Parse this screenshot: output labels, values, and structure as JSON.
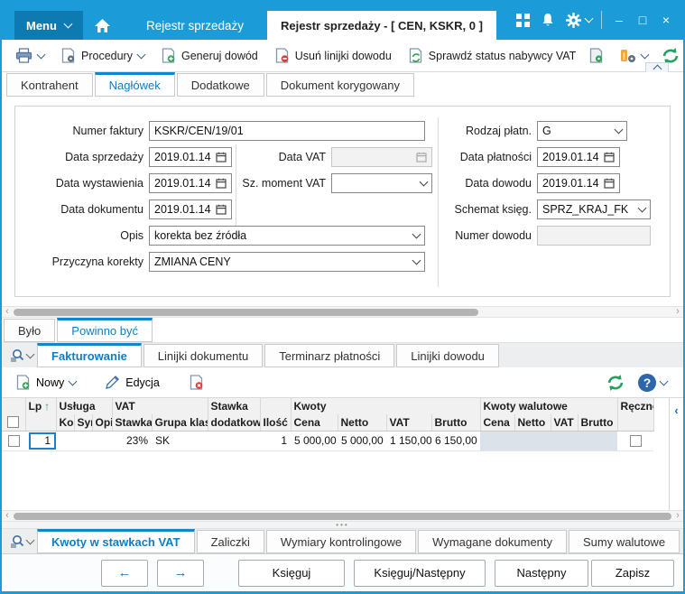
{
  "colors": {
    "titlebar": "#1b9cd8",
    "menu_button": "#0e7ab2",
    "accent_blue": "#0f7ec0",
    "icon_green": "#2fa456",
    "icon_red": "#d43f3a",
    "help_blue": "#2d66ad",
    "disabled_cell": "#dbe2e9"
  },
  "titlebar": {
    "menu": "Menu",
    "nav_item": "Rejestr sprzedaży",
    "document_tab": "Rejestr sprzedaży - [ CEN, KSKR, 0 ]"
  },
  "toolbar": {
    "procedury": "Procedury",
    "generuj_dowod": "Generuj dowód",
    "usun_linijki": "Usuń linijki dowodu",
    "sprawdz_vat": "Sprawdź status nabywcy VAT"
  },
  "form_tabs": [
    "Kontrahent",
    "Nagłówek",
    "Dodatkowe",
    "Dokument korygowany"
  ],
  "form": {
    "numer_faktury": {
      "label": "Numer faktury",
      "value": "KSKR/CEN/19/01"
    },
    "data_sprzedazy": {
      "label": "Data sprzedaży",
      "value": "2019.01.14"
    },
    "data_wystawienia": {
      "label": "Data wystawienia",
      "value": "2019.01.14"
    },
    "data_dokumentu": {
      "label": "Data dokumentu",
      "value": "2019.01.14"
    },
    "opis": {
      "label": "Opis",
      "value": "korekta bez źródła"
    },
    "przyczyna_korekty": {
      "label": "Przyczyna korekty",
      "value": "ZMIANA CENY"
    },
    "data_vat": {
      "label": "Data VAT",
      "value": ""
    },
    "sz_moment_vat": {
      "label": "Sz. moment VAT",
      "value": ""
    },
    "rodzaj_platn": {
      "label": "Rodzaj płatn.",
      "value": "G"
    },
    "data_platnosci": {
      "label": "Data płatności",
      "value": "2019.01.14"
    },
    "data_dowodu": {
      "label": "Data dowodu",
      "value": "2019.01.14"
    },
    "schemat_ksieg": {
      "label": "Schemat księg.",
      "value": "SPRZ_KRAJ_FK"
    },
    "numer_dowodu": {
      "label": "Numer dowodu",
      "value": ""
    }
  },
  "middle_tabs": [
    "Było",
    "Powinno być"
  ],
  "sub_tabs": [
    "Fakturowanie",
    "Linijki dokumentu",
    "Terminarz płatności",
    "Linijki dowodu"
  ],
  "grid_toolbar": {
    "nowy": "Nowy",
    "edycja": "Edycja"
  },
  "table": {
    "groups": {
      "lp": "Lp",
      "usluga": "Usługa",
      "vat": "VAT",
      "stawka_dodatkowa": "Stawka",
      "kwoty": "Kwoty",
      "kwoty_walutowe": "Kwoty walutowe",
      "reczne": "Ręczne"
    },
    "cols": {
      "kos": "Kos",
      "syn": "Syn",
      "opis": "Opis",
      "stawka": "Stawka",
      "grupa_klas": "Grupa klas.",
      "dodatkowa": "dodatkowa",
      "ilosc": "Ilość",
      "cena": "Cena",
      "netto": "Netto",
      "vat": "VAT",
      "brutto": "Brutto",
      "cena_wal": "Cena",
      "netto_wal": "Netto",
      "vat_wal": "VAT",
      "brutto_wal": "Brutto"
    },
    "row": {
      "lp": "1",
      "stawka_vat": "23%",
      "grupa_klas": "SK",
      "ilosc": "1",
      "cena": "5 000,00",
      "netto": "5 000,00",
      "vat": "1 150,00",
      "brutto": "6 150,00"
    }
  },
  "bottom_tabs": [
    "Kwoty w stawkach VAT",
    "Zaliczki",
    "Wymiary kontrolingowe",
    "Wymagane dokumenty",
    "Sumy walutowe"
  ],
  "footer": {
    "ksieguj": "Księguj",
    "ksieguj_nastepny": "Księguj/Następny",
    "nastepny": "Następny",
    "zapisz": "Zapisz"
  }
}
